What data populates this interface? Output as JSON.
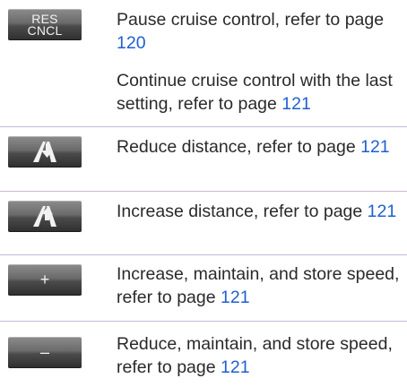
{
  "rows": [
    {
      "button": {
        "line1": "RES",
        "line2": "CNCL"
      },
      "paragraphs": [
        {
          "text": "Pause cruise control, refer to page ",
          "page": "120"
        },
        {
          "text": "Continue cruise control with the last setting, refer to page ",
          "page": "121"
        }
      ]
    },
    {
      "button": {
        "icon": "reduce-distance-icon"
      },
      "paragraphs": [
        {
          "text": "Reduce distance, refer to page ",
          "page": "121"
        }
      ]
    },
    {
      "button": {
        "icon": "increase-distance-icon"
      },
      "paragraphs": [
        {
          "text": "Increase distance, refer to page ",
          "page": "121"
        }
      ]
    },
    {
      "button": {
        "symbol": "+"
      },
      "paragraphs": [
        {
          "text": "Increase, maintain, and store speed, refer to page ",
          "page": "121"
        }
      ]
    },
    {
      "button": {
        "symbol": "–"
      },
      "paragraphs": [
        {
          "text": "Reduce, maintain, and store speed, refer to page ",
          "page": "121"
        }
      ]
    }
  ],
  "colors": {
    "link": "#1f5fd1",
    "separator": "#c9b7d6",
    "button_face": "#4b4b4b"
  }
}
